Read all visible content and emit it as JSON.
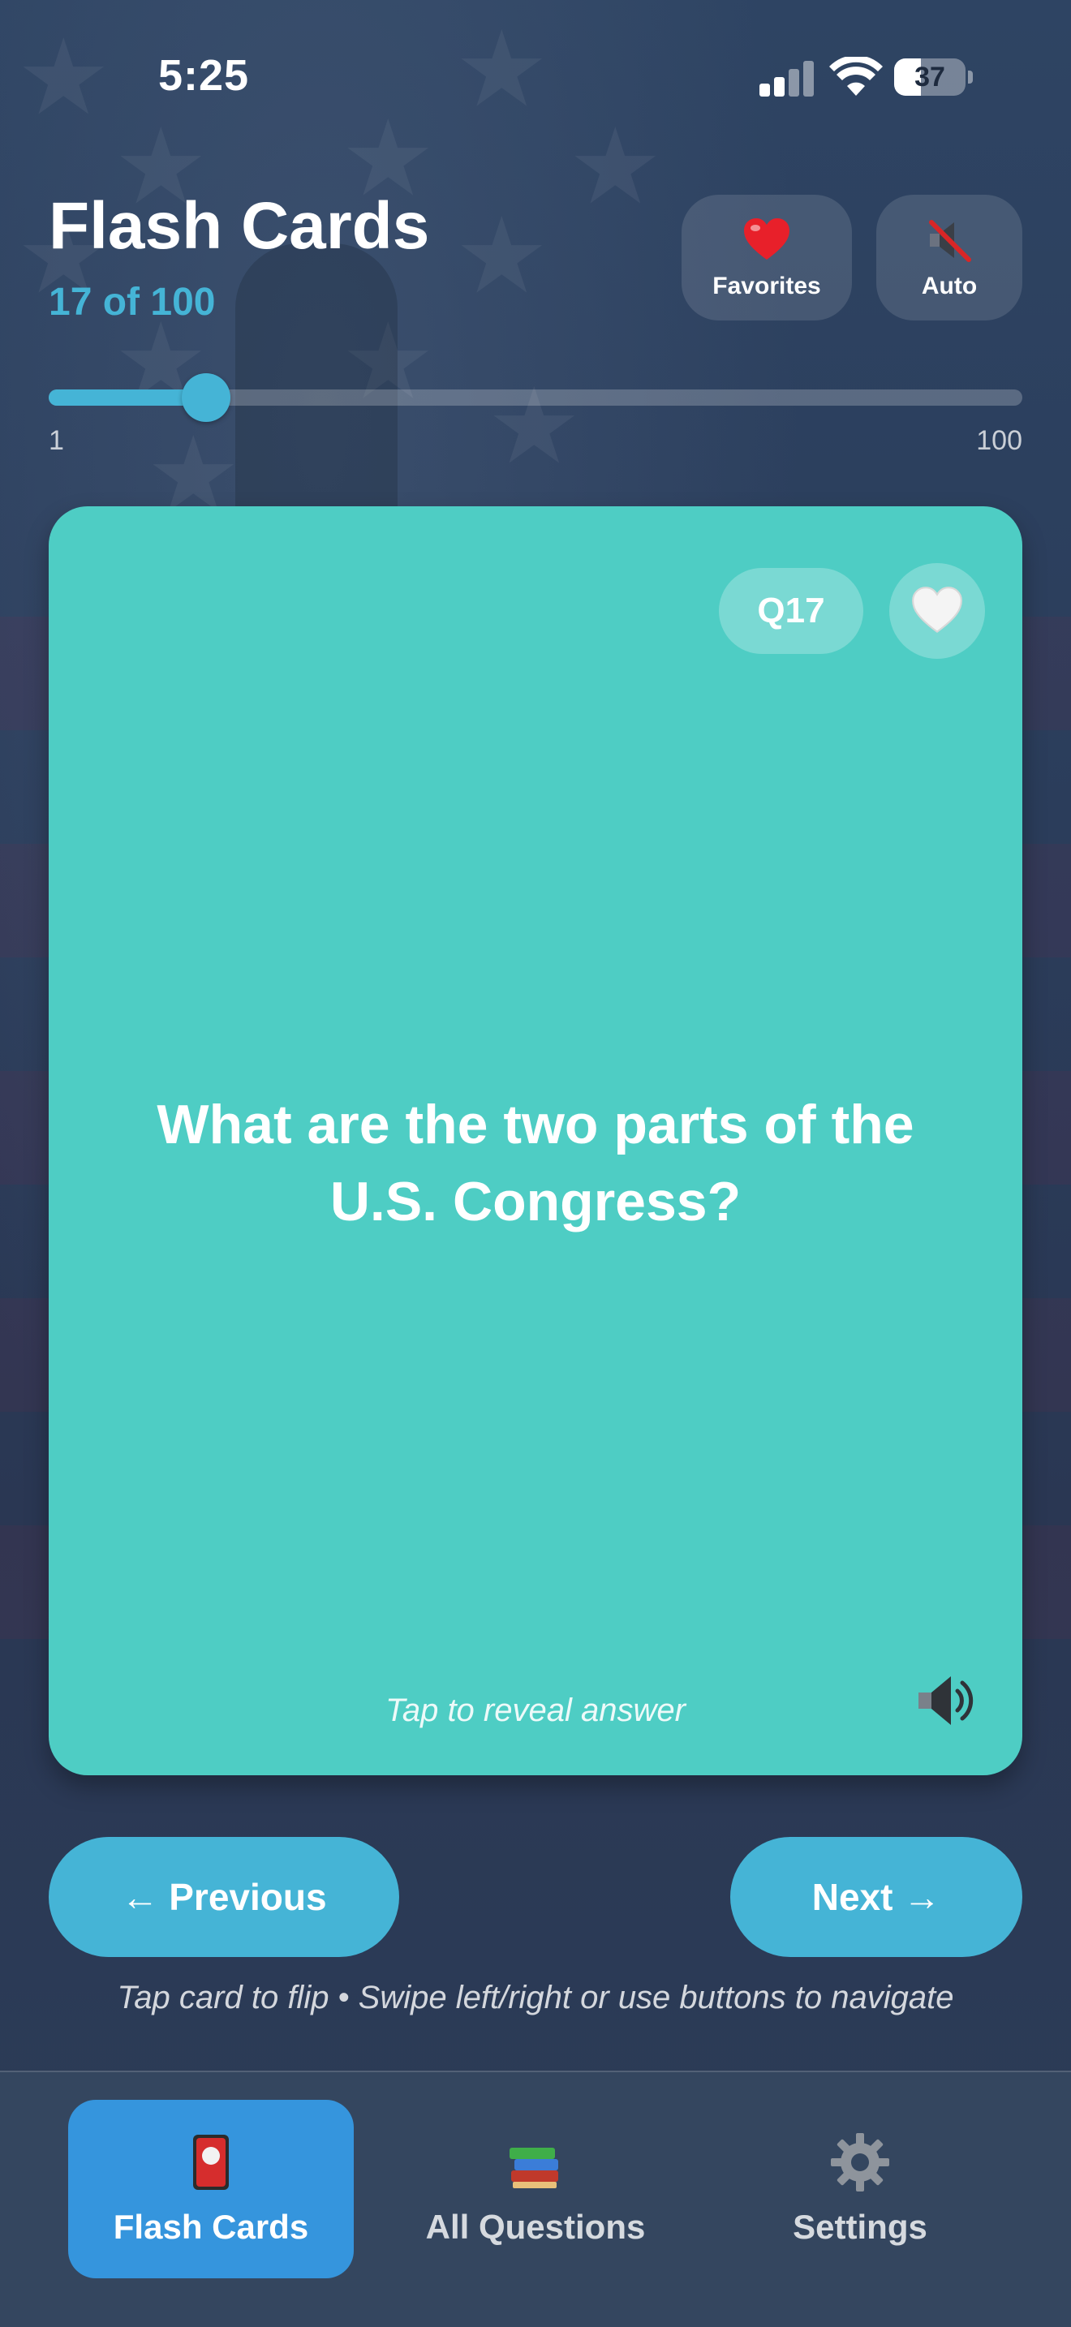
{
  "status_bar": {
    "time": "5:25",
    "battery": "37",
    "battery_level": 0.37
  },
  "header": {
    "title": "Flash Cards",
    "progress": "17 of 100",
    "favorites_label": "Favorites",
    "auto_label": "Auto"
  },
  "slider": {
    "min_label": "1",
    "max_label": "100",
    "value": 17,
    "min": 1,
    "max": 100
  },
  "card": {
    "badge": "Q17",
    "question": "What are the two parts of the U.S. Congress?",
    "hint": "Tap to reveal answer"
  },
  "navigation": {
    "previous_label": "← Previous",
    "next_label": "Next →",
    "instructions": "Tap card to flip • Swipe left/right or use buttons to navigate"
  },
  "tabs": [
    {
      "label": "Flash Cards",
      "icon": "flash-card-icon",
      "active": true
    },
    {
      "label": "All Questions",
      "icon": "books-icon",
      "active": false
    },
    {
      "label": "Settings",
      "icon": "gear-icon",
      "active": false
    }
  ],
  "colors": {
    "accent": "#45b4d6",
    "card": "#4ecdc4",
    "active_tab": "#3595dd"
  }
}
